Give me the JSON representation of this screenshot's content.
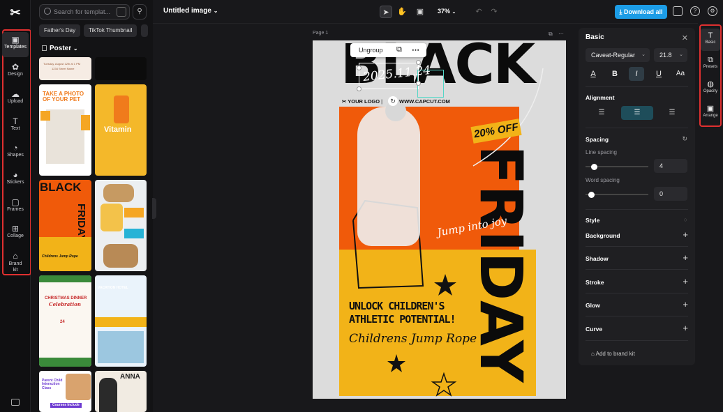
{
  "app": {
    "doc_title": "Untitled image",
    "zoom": "37%",
    "download_label": "Download all",
    "page_label": "Page 1"
  },
  "rail": {
    "items": [
      {
        "label": "Templates",
        "icon": "templates-icon",
        "glyph": "▣"
      },
      {
        "label": "Design",
        "icon": "design-icon",
        "glyph": "✿"
      },
      {
        "label": "Upload",
        "icon": "upload-icon",
        "glyph": "☁"
      },
      {
        "label": "Text",
        "icon": "text-icon",
        "glyph": "T"
      },
      {
        "label": "Shapes",
        "icon": "shapes-icon",
        "glyph": "◔"
      },
      {
        "label": "Stickers",
        "icon": "stickers-icon",
        "glyph": "◕"
      },
      {
        "label": "Frames",
        "icon": "frames-icon",
        "glyph": "▢"
      },
      {
        "label": "Collage",
        "icon": "collage-icon",
        "glyph": "⊞"
      },
      {
        "label": "Brand kit",
        "icon": "brand-kit-icon",
        "glyph": "⌂"
      }
    ]
  },
  "panel": {
    "search_placeholder": "Search for templat...",
    "chips": [
      "Father's Day",
      "TikTok Thumbnail"
    ],
    "category": "Poster",
    "thumbs": {
      "t1_line": "Tuesday, August 12th at 1 PM",
      "t1_sub": "1234 Street Name",
      "photo_title": "TAKE A PHOTO OF YOUR PET",
      "vitamin": "Vitamin",
      "bf_title": "BLACK",
      "bf_side": "FRIDAY",
      "bf_sub": "Childrens Jump Rope",
      "xmas_title": "CHRISTMAS DINNER",
      "xmas_script": "Celebration",
      "xmas_num": "24",
      "hotel": "VACATION HOTEL",
      "parent": "Parent Child Interaction Class",
      "courses": "Courses Include",
      "anna": "ANNA"
    }
  },
  "canvas": {
    "black": "BLACK",
    "friday": "FRIDAY",
    "date": "2025.11.24",
    "logo": "YOUR LOGO",
    "site": "WWW.CAPCUT.COM",
    "discount": "20% OFF",
    "script": "Jump into joy",
    "headline1": "UNLOCK CHILDREN'S",
    "headline2": "ATHLETIC POTENTIAL!",
    "product": "Childrens Jump Rope",
    "ungroup": "Ungroup"
  },
  "props": {
    "title": "Basic",
    "font": "Caveat-Regular",
    "size": "21.8",
    "alignment": "Alignment",
    "spacing": "Spacing",
    "line_spacing": "Line spacing",
    "line_value": "4",
    "word_spacing": "Word spacing",
    "word_value": "0",
    "style": "Style",
    "sections": [
      "Background",
      "Shadow",
      "Stroke",
      "Glow",
      "Curve"
    ],
    "brand": "Add to brand kit"
  },
  "tabs": [
    {
      "label": "Basic",
      "icon": "basic-text-icon",
      "glyph": "T"
    },
    {
      "label": "Presets",
      "icon": "presets-icon",
      "glyph": "⧉"
    },
    {
      "label": "Opacity",
      "icon": "opacity-icon",
      "glyph": "◍"
    },
    {
      "label": "Arrange",
      "icon": "arrange-icon",
      "glyph": "▣"
    }
  ],
  "colors": {
    "accent": "#1c9ce6",
    "highlight": "#e03030",
    "selection": "#53d6c6"
  }
}
